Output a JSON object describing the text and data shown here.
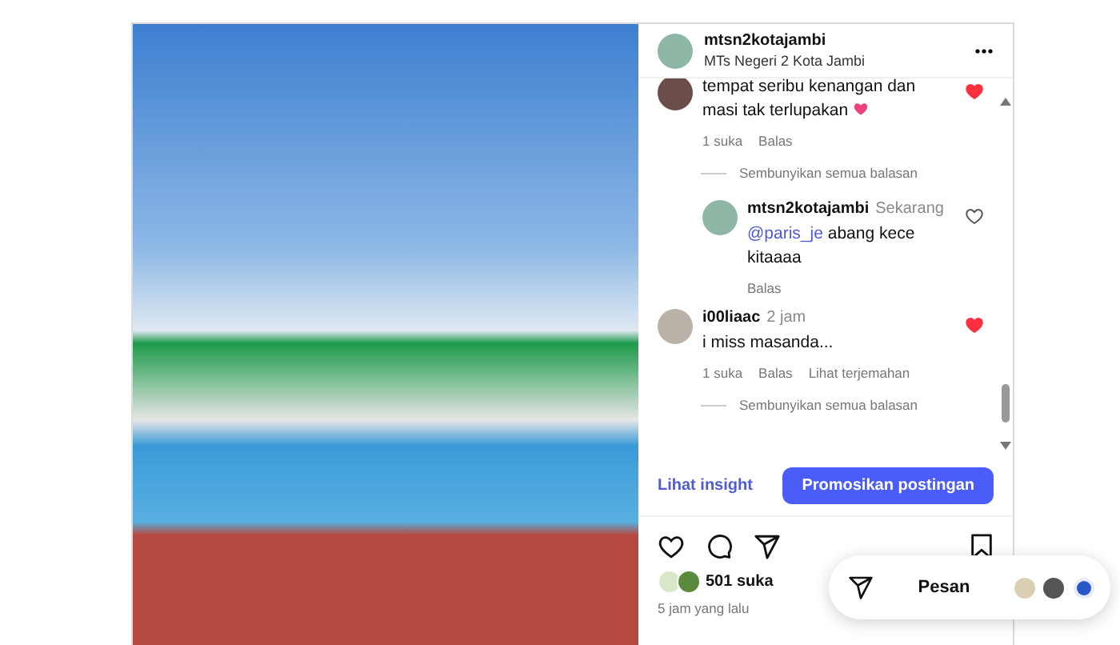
{
  "post": {
    "username": "mtsn2kotajambi",
    "subtitle": "MTs Negeri 2 Kota Jambi",
    "comments": [
      {
        "text": "tempat seribu kenangan dan masi tak terlupakan",
        "liked": true,
        "likes": "1 suka",
        "reply": "Balas",
        "hide_replies": "Sembunyikan semua balasan",
        "children": [
          {
            "username": "mtsn2kotajambi",
            "time": "Sekarang",
            "mention": "@paris_je",
            "text": "abang kece kitaaaa",
            "liked": false,
            "reply": "Balas"
          }
        ]
      },
      {
        "username": "i00liaac",
        "time": "2 jam",
        "text": "i miss masanda...",
        "liked": true,
        "likes": "1 suka",
        "reply": "Balas",
        "translate": "Lihat terjemahan",
        "hide_replies": "Sembunyikan semua balasan"
      }
    ],
    "insight": "Lihat insight",
    "promote": "Promosikan postingan",
    "likes": "501 suka",
    "time_ago": "5 jam yang lalu"
  },
  "message_bar": {
    "label": "Pesan"
  }
}
